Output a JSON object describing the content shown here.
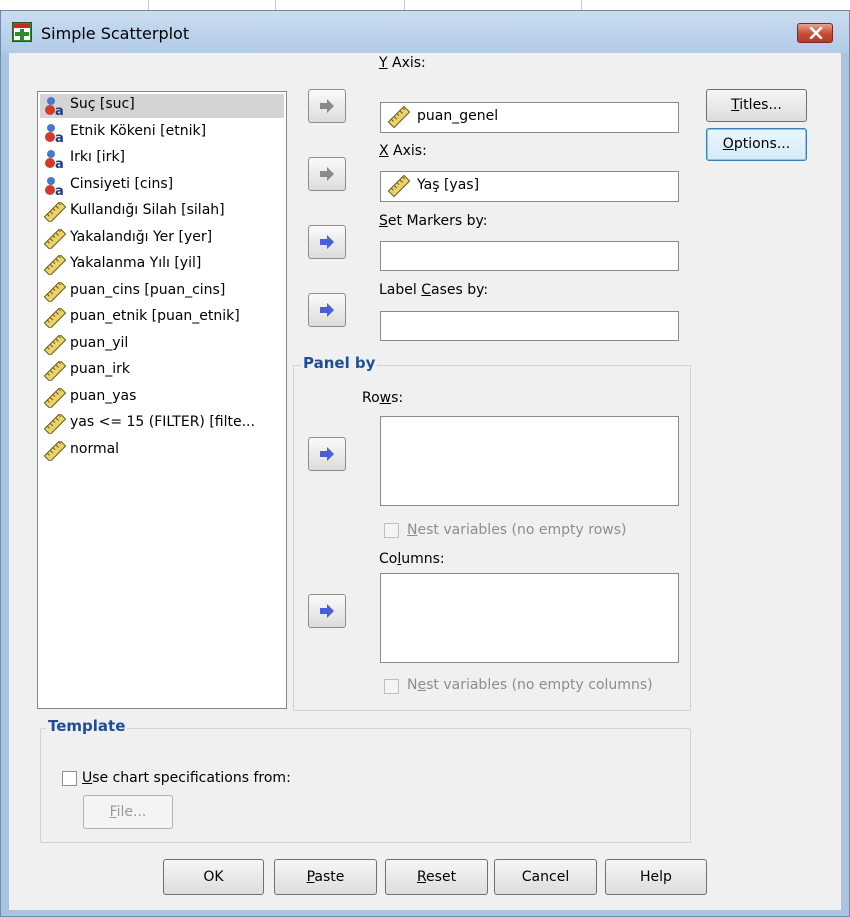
{
  "window": {
    "title": "Simple Scatterplot"
  },
  "variables": [
    {
      "label": "Suç [suc]",
      "type": "nominal",
      "selected": true
    },
    {
      "label": "Etnik Kökeni [etnik]",
      "type": "nominal"
    },
    {
      "label": "Irkı [irk]",
      "type": "nominal"
    },
    {
      "label": "Cinsiyeti [cins]",
      "type": "nominal"
    },
    {
      "label": "Kullandığı Silah [silah]",
      "type": "scale"
    },
    {
      "label": "Yakalandığı Yer [yer]",
      "type": "scale"
    },
    {
      "label": "Yakalanma Yılı [yil]",
      "type": "scale"
    },
    {
      "label": "puan_cins [puan_cins]",
      "type": "scale"
    },
    {
      "label": "puan_etnik [puan_etnik]",
      "type": "scale"
    },
    {
      "label": "puan_yil",
      "type": "scale"
    },
    {
      "label": "puan_irk",
      "type": "scale"
    },
    {
      "label": "puan_yas",
      "type": "scale"
    },
    {
      "label": "yas <= 15 (FILTER) [filte...",
      "type": "scale"
    },
    {
      "label": "normal",
      "type": "scale"
    }
  ],
  "fields": {
    "y_axis": {
      "label_u": "Y",
      "label_rest": " Axis:",
      "value": "puan_genel"
    },
    "x_axis": {
      "label_u": "X",
      "label_rest": " Axis:",
      "value": "Yaş [yas]"
    },
    "markers": {
      "label_u": "S",
      "label_rest": "et Markers by:",
      "value": ""
    },
    "label_cases": {
      "label_pre": "Label ",
      "label_u": "C",
      "label_rest": "ases by:",
      "value": ""
    }
  },
  "panel": {
    "legend": "Panel by",
    "rows_pre": "Ro",
    "rows_u": "w",
    "rows_rest": "s:",
    "nest_rows_pre": "",
    "nest_rows_u": "N",
    "nest_rows_rest": "est variables (no empty rows)",
    "columns_pre": "Co",
    "columns_u": "l",
    "columns_rest": "umns:",
    "nest_cols_pre": "N",
    "nest_cols_u": "e",
    "nest_cols_rest": "st variables (no empty columns)"
  },
  "template": {
    "legend": "Template",
    "use_u": "U",
    "use_rest": "se chart specifications from:",
    "file_u": "F",
    "file_rest": "ile..."
  },
  "side_buttons": {
    "titles_u": "T",
    "titles_rest": "itles...",
    "options_u": "O",
    "options_rest": "ptions..."
  },
  "bottom_buttons": {
    "ok": "OK",
    "paste_u": "P",
    "paste_rest": "aste",
    "reset_u": "R",
    "reset_rest": "eset",
    "cancel": "Cancel",
    "help": "Help"
  },
  "colors": {
    "legend": "#1f4e99",
    "arrow_active": "#4a5ed6",
    "arrow_inactive": "#8a8a8a"
  }
}
